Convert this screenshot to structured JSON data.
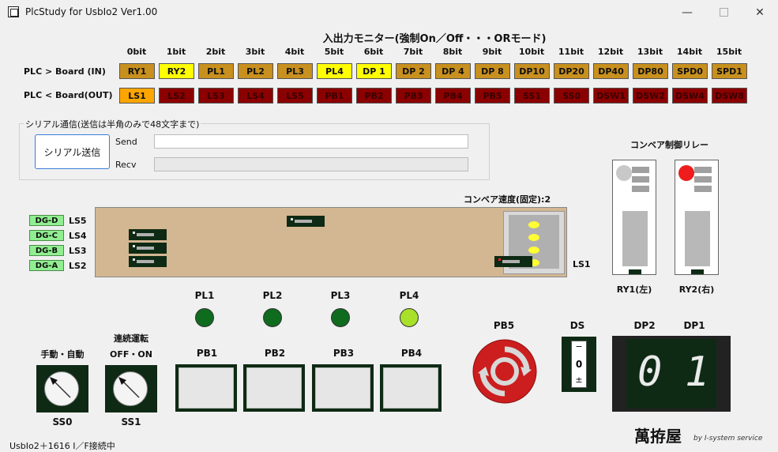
{
  "window": {
    "title": "PlcStudy for UsbIo2 Ver1.00"
  },
  "monitor": {
    "title": "入出力モニター(強制On／Off・・・ORモード)",
    "bits": [
      "0bit",
      "1bit",
      "2bit",
      "3bit",
      "4bit",
      "5bit",
      "6bit",
      "7bit",
      "8bit",
      "9bit",
      "10bit",
      "11bit",
      "12bit",
      "13bit",
      "14bit",
      "15bit"
    ],
    "in_row": {
      "label": "PLC > Board (IN)",
      "cells": [
        {
          "label": "RY1",
          "on": false
        },
        {
          "label": "RY2",
          "on": true
        },
        {
          "label": "PL1",
          "on": false
        },
        {
          "label": "PL2",
          "on": false
        },
        {
          "label": "PL3",
          "on": false
        },
        {
          "label": "PL4",
          "on": true
        },
        {
          "label": "DP 1",
          "on": true
        },
        {
          "label": "DP 2",
          "on": false
        },
        {
          "label": "DP 4",
          "on": false
        },
        {
          "label": "DP 8",
          "on": false
        },
        {
          "label": "DP10",
          "on": false
        },
        {
          "label": "DP20",
          "on": false
        },
        {
          "label": "DP40",
          "on": false
        },
        {
          "label": "DP80",
          "on": false
        },
        {
          "label": "SPD0",
          "on": false
        },
        {
          "label": "SPD1",
          "on": false
        }
      ]
    },
    "out_row": {
      "label": "PLC < Board(OUT)",
      "cells": [
        {
          "label": "LS1",
          "on": true
        },
        {
          "label": "LS2",
          "on": false
        },
        {
          "label": "LS3",
          "on": false
        },
        {
          "label": "LS4",
          "on": false
        },
        {
          "label": "LS5",
          "on": false
        },
        {
          "label": "PB1",
          "on": false
        },
        {
          "label": "PB2",
          "on": false
        },
        {
          "label": "PB3",
          "on": false
        },
        {
          "label": "PB4",
          "on": false
        },
        {
          "label": "PB5",
          "on": false
        },
        {
          "label": "SS1",
          "on": false
        },
        {
          "label": "SS0",
          "on": false
        },
        {
          "label": "DSW1",
          "on": false
        },
        {
          "label": "DSW2",
          "on": false
        },
        {
          "label": "DSW4",
          "on": false
        },
        {
          "label": "DSW8",
          "on": false
        }
      ]
    },
    "colors": {
      "in_off": "#c8901e",
      "in_on": "#ffff00",
      "out_off": "#8b0000",
      "out_on": "#ffa500"
    }
  },
  "serial": {
    "title": "シリアル通信(送信は半角のみで48文字まで)",
    "send_button": "シリアル送信",
    "send_label": "Send",
    "send_value": "",
    "recv_label": "Recv",
    "recv_value": ""
  },
  "conveyor": {
    "speed_label": "コンベア速度(固定):2",
    "sensors": [
      "DG-D",
      "DG-C",
      "DG-B",
      "DG-A"
    ],
    "limit_switches": [
      "LS5",
      "LS4",
      "LS3",
      "LS2"
    ],
    "ls1_label": "LS1"
  },
  "relay": {
    "title": "コンベア制御リレー",
    "items": [
      {
        "label": "RY1(左)",
        "on": false
      },
      {
        "label": "RY2(右)",
        "on": true
      }
    ]
  },
  "lamps": [
    {
      "label": "PL1",
      "color": "#0f6b1e"
    },
    {
      "label": "PL2",
      "color": "#0f6b1e"
    },
    {
      "label": "PL3",
      "color": "#0f6b1e"
    },
    {
      "label": "PL4",
      "color": "#a8e02a"
    }
  ],
  "selectors": [
    {
      "top_label": "",
      "label": "手動・自動",
      "bottom_label": "SS0"
    },
    {
      "top_label": "連続運転",
      "label": "OFF・ON",
      "bottom_label": "SS1"
    }
  ],
  "push_buttons": [
    "PB1",
    "PB2",
    "PB3",
    "PB4"
  ],
  "pb5": {
    "label": "PB5"
  },
  "ds": {
    "label": "DS",
    "minus": "−",
    "value": "0",
    "plus": "±"
  },
  "display": {
    "label_left": "DP2",
    "label_right": "DP1",
    "digit_left": "0",
    "digit_right": "1"
  },
  "status": {
    "text": "UsbIo2＋1616 I／F接続中"
  },
  "brand": {
    "name": "萬拵屋",
    "sub": "by I-system service"
  }
}
